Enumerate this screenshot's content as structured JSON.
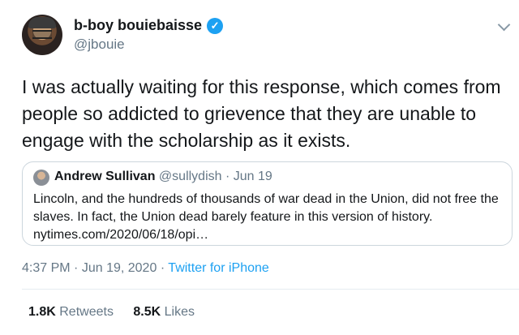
{
  "author": {
    "display_name": "b-boy bouiebaisse",
    "handle": "@jbouie",
    "verified_icon": "✓"
  },
  "tweet": {
    "text": "I was actually waiting for this response, which comes from people so addicted to grievence that they are unable to engage with the scholarship as it exists."
  },
  "quoted": {
    "name": "Andrew Sullivan",
    "handle": "@sullydish",
    "separator": "·",
    "date": "Jun 19",
    "text": "Lincoln, and the hundreds of thousands of war dead in the Union, did not free the slaves. In fact, the Union dead barely feature in this version of history. nytimes.com/2020/06/18/opi…"
  },
  "meta": {
    "time": "4:37 PM",
    "separator": "·",
    "date": "Jun 19, 2020",
    "source": "Twitter for iPhone"
  },
  "stats": {
    "retweets_count": "1.8K",
    "retweets_label": "Retweets",
    "likes_count": "8.5K",
    "likes_label": "Likes"
  },
  "colors": {
    "accent": "#1da1f2",
    "muted": "#657786",
    "text": "#14171a",
    "border": "#ccd6dd"
  },
  "icons": {
    "menu": "chevron-down-icon",
    "verified": "verified-badge-icon"
  }
}
